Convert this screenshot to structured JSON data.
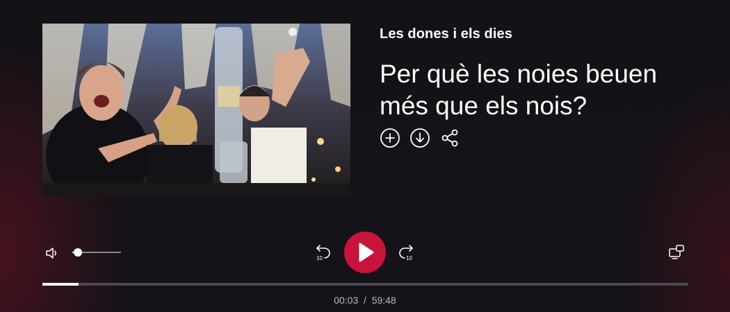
{
  "program": {
    "name": "Les dones i els dies"
  },
  "episode": {
    "title": "Per què les noies beuen més que els nois?"
  },
  "actions": [
    {
      "icon": "add-circle-icon"
    },
    {
      "icon": "download-circle-icon"
    },
    {
      "icon": "share-icon"
    }
  ],
  "player": {
    "current_time": "00:03",
    "separator": "/",
    "duration": "59:48",
    "progress_fraction": 0.056,
    "volume_fraction": 0.12,
    "rewind_seconds": "10",
    "forward_seconds": "10",
    "accent_color": "#c8143b"
  }
}
